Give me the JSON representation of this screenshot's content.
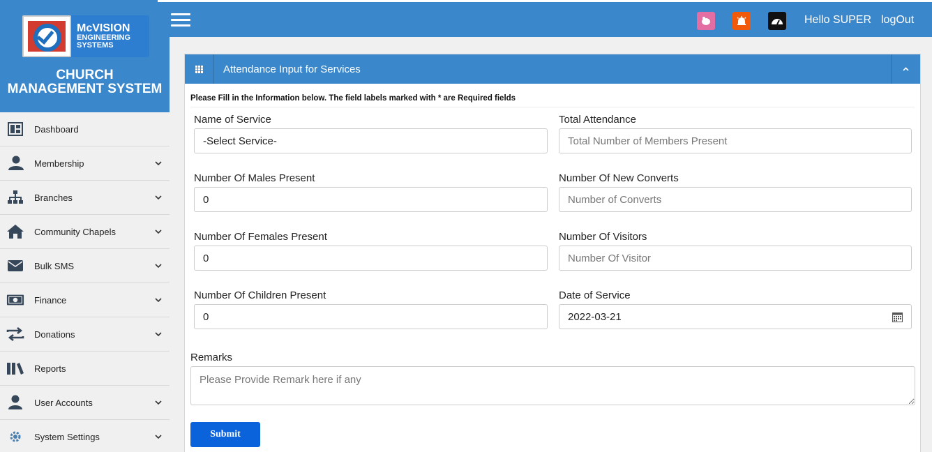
{
  "brand": {
    "logo_line1": "McVISION",
    "logo_line2": "ENGINEERING",
    "logo_line3": "SYSTEMS",
    "title_line1": "CHURCH",
    "title_line2": "MANAGEMENT SYSTEM"
  },
  "colors": {
    "primary": "#3a87cc",
    "submit": "#0a63db",
    "icon_pink": "#e36ea3",
    "icon_orange": "#f05a0a",
    "icon_black": "#111111"
  },
  "sidebar": {
    "items": [
      {
        "label": "Dashboard",
        "icon": "dashboard-icon",
        "has_chevron": false
      },
      {
        "label": "Membership",
        "icon": "user-icon",
        "has_chevron": true
      },
      {
        "label": "Branches",
        "icon": "sitemap-icon",
        "has_chevron": true
      },
      {
        "label": "Community Chapels",
        "icon": "home-icon",
        "has_chevron": true
      },
      {
        "label": "Bulk SMS",
        "icon": "envelope-icon",
        "has_chevron": true
      },
      {
        "label": "Finance",
        "icon": "money-icon",
        "has_chevron": true
      },
      {
        "label": "Donations",
        "icon": "exchange-icon",
        "has_chevron": true
      },
      {
        "label": "Reports",
        "icon": "books-icon",
        "has_chevron": false
      },
      {
        "label": "User Accounts",
        "icon": "user-icon",
        "has_chevron": true
      },
      {
        "label": "System Settings",
        "icon": "gear-icon",
        "has_chevron": true
      }
    ]
  },
  "topbar": {
    "greeting": "Hello SUPER",
    "logout": "logOut",
    "icons": [
      "piggy-bank-icon",
      "alarm-icon",
      "speedometer-icon"
    ]
  },
  "form": {
    "title": "Attendance Input for Services",
    "instructions": "Please Fill in the Information below. The field labels marked with * are Required fields",
    "name_of_service": {
      "label": "Name of Service",
      "value": "-Select Service-"
    },
    "total_attendance": {
      "label": "Total Attendance",
      "placeholder": "Total Number of Members Present"
    },
    "males": {
      "label": "Number Of Males Present",
      "value": "0"
    },
    "new_converts": {
      "label": "Number Of New Converts",
      "placeholder": "Number of Converts"
    },
    "females": {
      "label": "Number Of Females Present",
      "value": "0"
    },
    "visitors": {
      "label": "Number Of Visitors",
      "placeholder": "Number Of Visitor"
    },
    "children": {
      "label": "Number Of Children Present",
      "value": "0"
    },
    "date_of_service": {
      "label": "Date of Service",
      "value": "2022-03-21"
    },
    "remarks": {
      "label": "Remarks",
      "placeholder": "Please Provide Remark here if any"
    },
    "submit_label": "Submit"
  }
}
